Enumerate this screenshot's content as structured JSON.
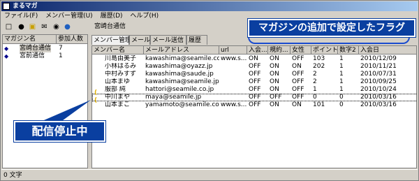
{
  "window": {
    "title": "まるマガ"
  },
  "menu": [
    "ファイル(F)",
    "メンバー管理(U)",
    "履歴(D)",
    "ヘルプ(H)"
  ],
  "toolbar_icons": [
    "new-doc-icon",
    "members-icon",
    "folder-icon",
    "mail-icon",
    "binoculars-icon",
    "globe-icon"
  ],
  "left_pane": {
    "headers": [
      "マガジン名",
      "参加人数"
    ],
    "rows": [
      {
        "name": "宮崎台通信",
        "count": "7",
        "selected": true
      },
      {
        "name": "宮前通信",
        "count": "1",
        "selected": false
      }
    ]
  },
  "channel_label": "宮崎台通信",
  "tabs": [
    "メンバー管理",
    "メール",
    "メール送信",
    "履歴"
  ],
  "grid": {
    "headers": [
      "メンバー名",
      "メールアドレス",
      "url",
      "入会...",
      "規約...",
      "女性",
      "ポイント",
      "数字2",
      "入会日"
    ],
    "rows": [
      [
        "川島由美子",
        "kawashima@seamile.co.jp",
        "www.s...",
        "ON",
        "ON",
        "OFF",
        "103",
        "1",
        "2010/12/09"
      ],
      [
        "小林はるみ",
        "kawashima@oyazz.jp",
        "",
        "OFF",
        "ON",
        "ON",
        "202",
        "1",
        "2010/11/21"
      ],
      [
        "中村みすず",
        "kawashima@saude.jp",
        "",
        "OFF",
        "ON",
        "OFF",
        "2",
        "1",
        "2010/07/31"
      ],
      [
        "山本まゆ",
        "kawashima@seamile.jp",
        "",
        "OFF",
        "ON",
        "OFF",
        "2",
        "1",
        "2010/09/25"
      ],
      [
        "服部 純",
        "hattori@seamile.co.jp",
        "",
        "OFF",
        "ON",
        "OFF",
        "1",
        "1",
        "2010/10/24"
      ],
      [
        "中川まや",
        "maya@seamile.jp",
        "",
        "OFF",
        "OFF",
        "OFF",
        "0",
        "0",
        "2010/03/16"
      ],
      [
        "山本まこ",
        "yamamoto@seamile.com",
        "www.s...",
        "OFF",
        "ON",
        "ON",
        "101",
        "0",
        "2010/03/16"
      ]
    ]
  },
  "status": "0 文字",
  "callouts": {
    "flag": "マガジンの追加で設定したフラグ",
    "stopped": "配信停止中"
  }
}
